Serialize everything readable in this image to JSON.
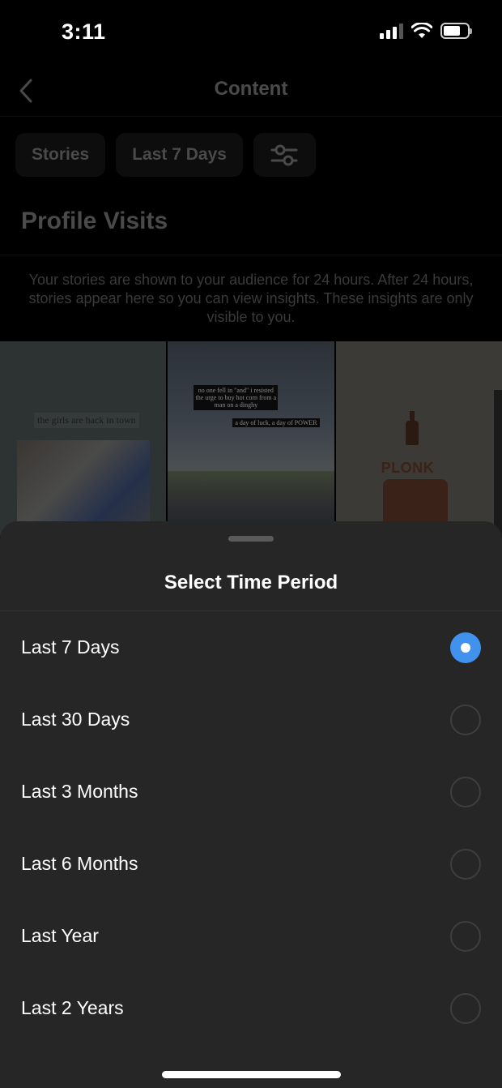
{
  "status_bar": {
    "time": "3:11",
    "icons": [
      "cellular-signal-icon",
      "wifi-icon",
      "battery-icon"
    ]
  },
  "nav": {
    "back_icon": "chevron-left-icon",
    "title": "Content"
  },
  "filters": {
    "content_type": "Stories",
    "time_period": "Last 7 Days",
    "filter_icon": "sliders-icon"
  },
  "section": {
    "title": "Profile Visits",
    "info": "Your stories are shown to your audience for 24 hours. After 24 hours, stories appear here so you can view insights. These insights are only visible to you."
  },
  "stories": [
    {
      "caption": "the girls are back in town"
    },
    {
      "caption": "no one fell in \"and\" i resisted the urge to buy hot corn from a man on a dinghy",
      "caption_2": "a day of luck, a day of POWER"
    },
    {
      "caption": "PLONK"
    }
  ],
  "sheet": {
    "title": "Select Time Period",
    "accent_color": "#4192ec",
    "selected": "Last 7 Days",
    "options": [
      {
        "label": "Last 7 Days",
        "selected": true
      },
      {
        "label": "Last 30 Days",
        "selected": false
      },
      {
        "label": "Last 3 Months",
        "selected": false
      },
      {
        "label": "Last 6 Months",
        "selected": false
      },
      {
        "label": "Last Year",
        "selected": false
      },
      {
        "label": "Last 2 Years",
        "selected": false
      }
    ]
  }
}
